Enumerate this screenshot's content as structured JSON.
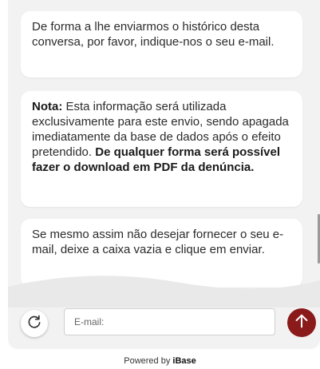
{
  "messages": [
    {
      "text": "De forma a lhe enviarmos o histórico desta conversa, por favor, indique-nos o seu e-mail."
    },
    {
      "note_label": "Nota:",
      "note_text": " Esta informação será utilizada exclusivamente para este envio, sendo apagada imediatamente da base de dados após o efeito pretendido. ",
      "note_bold": "De qualquer forma será possível fazer o download em PDF da denúncia."
    },
    {
      "text": "Se mesmo assim não desejar fornecer o seu e-mail, deixe a caixa vazia e clique em enviar."
    }
  ],
  "input": {
    "placeholder": "E-mail:",
    "value": ""
  },
  "icons": {
    "refresh": "refresh-icon",
    "send": "arrow-up-icon"
  },
  "colors": {
    "send_button": "#8b1a1a",
    "panel_background": "#f2f2f2",
    "bubble_background": "#ffffff"
  },
  "footer": {
    "prefix": "Powered by ",
    "brand": "iBase"
  }
}
